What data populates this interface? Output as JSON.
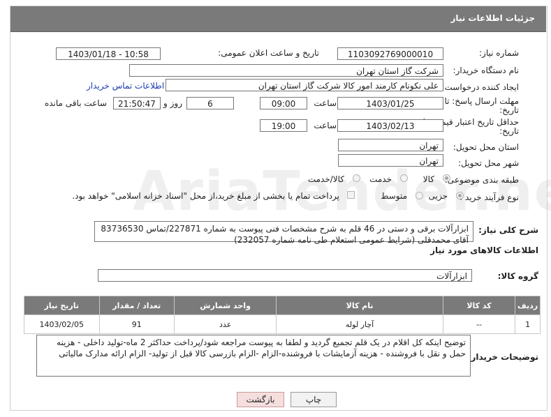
{
  "header": {
    "title": "جزئیات اطلاعات نیاز"
  },
  "fields": {
    "need_number_label": "شماره نیاز:",
    "need_number": "1103092769000010",
    "announce_label": "تاریخ و ساعت اعلان عمومی:",
    "announce_value": "1403/01/18 - 10:58",
    "buyer_org_label": "نام دستگاه خریدار:",
    "buyer_org": "شرکت گاز استان تهران",
    "requester_label": "ایجاد کننده درخواست:",
    "requester": "علی نکونام کارمند امور کالا شرکت گاز استان تهران",
    "contact_link": "اطلاعات تماس خریدار",
    "reply_deadline_label": "مهلت ارسال پاسخ: تا",
    "reply_deadline_label2": "تاریخ:",
    "reply_date": "1403/01/25",
    "time_label": "ساعت",
    "reply_time": "09:00",
    "days_value": "6",
    "days_label": "روز و",
    "remaining_time": "21:50:47",
    "remaining_label": "ساعت باقی مانده",
    "validity_label": "حداقل تاریخ اعتبار قیمت: تا",
    "validity_label2": "تاریخ:",
    "validity_date": "1403/02/13",
    "validity_time": "19:00",
    "province_label": "استان محل تحویل:",
    "province": "تهران",
    "city_label": "شهر محل تحویل:",
    "city": "تهران",
    "category_label": "طبقه بندی موضوعی:",
    "category_options": [
      "کالا",
      "خدمت",
      "کالا/خدمت"
    ],
    "process_label": "نوع فرآیند خرید :",
    "process_options": [
      "جزیی",
      "متوسط"
    ],
    "payment_note": "پرداخت تمام یا بخشی از مبلغ خرید،از محل \"اسناد خزانه اسلامی\" خواهد بود."
  },
  "general_desc": {
    "label": "شرح کلی نیاز:",
    "text": "ابزارآلات برقی و دستی در 46 قلم به شرح مشخصات فنی پیوست به شماره 227871/تماس 83736530 آقای محمدقلی  (شرایط عمومی استعلام طی نامه شماره 232057)"
  },
  "goods_section": {
    "title": "اطلاعات کالاهای مورد نیاز",
    "group_label": "گروه کالا:",
    "group_value": "ابزارآلات"
  },
  "table": {
    "headers": [
      "ردیف",
      "کد کالا",
      "نام کالا",
      "واحد شمارش",
      "تعداد / مقدار",
      "تاریخ نیاز"
    ],
    "rows": [
      [
        "1",
        "--",
        "آچار لوله",
        "عدد",
        "91",
        "1403/02/05"
      ]
    ]
  },
  "buyer_notes": {
    "label": "توضیحات خریدار:",
    "text": "توضیح اینکه کل اقلام در یک قلم تجمیع گردید و لطفا به پیوست مراجعه شود/پرداخت حداکثر 2 ماه-تولید داخلی - هزینه حمل و نقل با فروشنده - هزینه آزمایشات با فروشنده-الزام  -الزام بازرسی کالا قبل از تولید- الزام ارائه مدارک مالیاتی"
  },
  "buttons": {
    "print": "چاپ",
    "back": "بازگشت"
  },
  "colors": {
    "header_bg": "#7a7a7a",
    "link": "#1a3db3",
    "back_btn": "#f5dede"
  }
}
